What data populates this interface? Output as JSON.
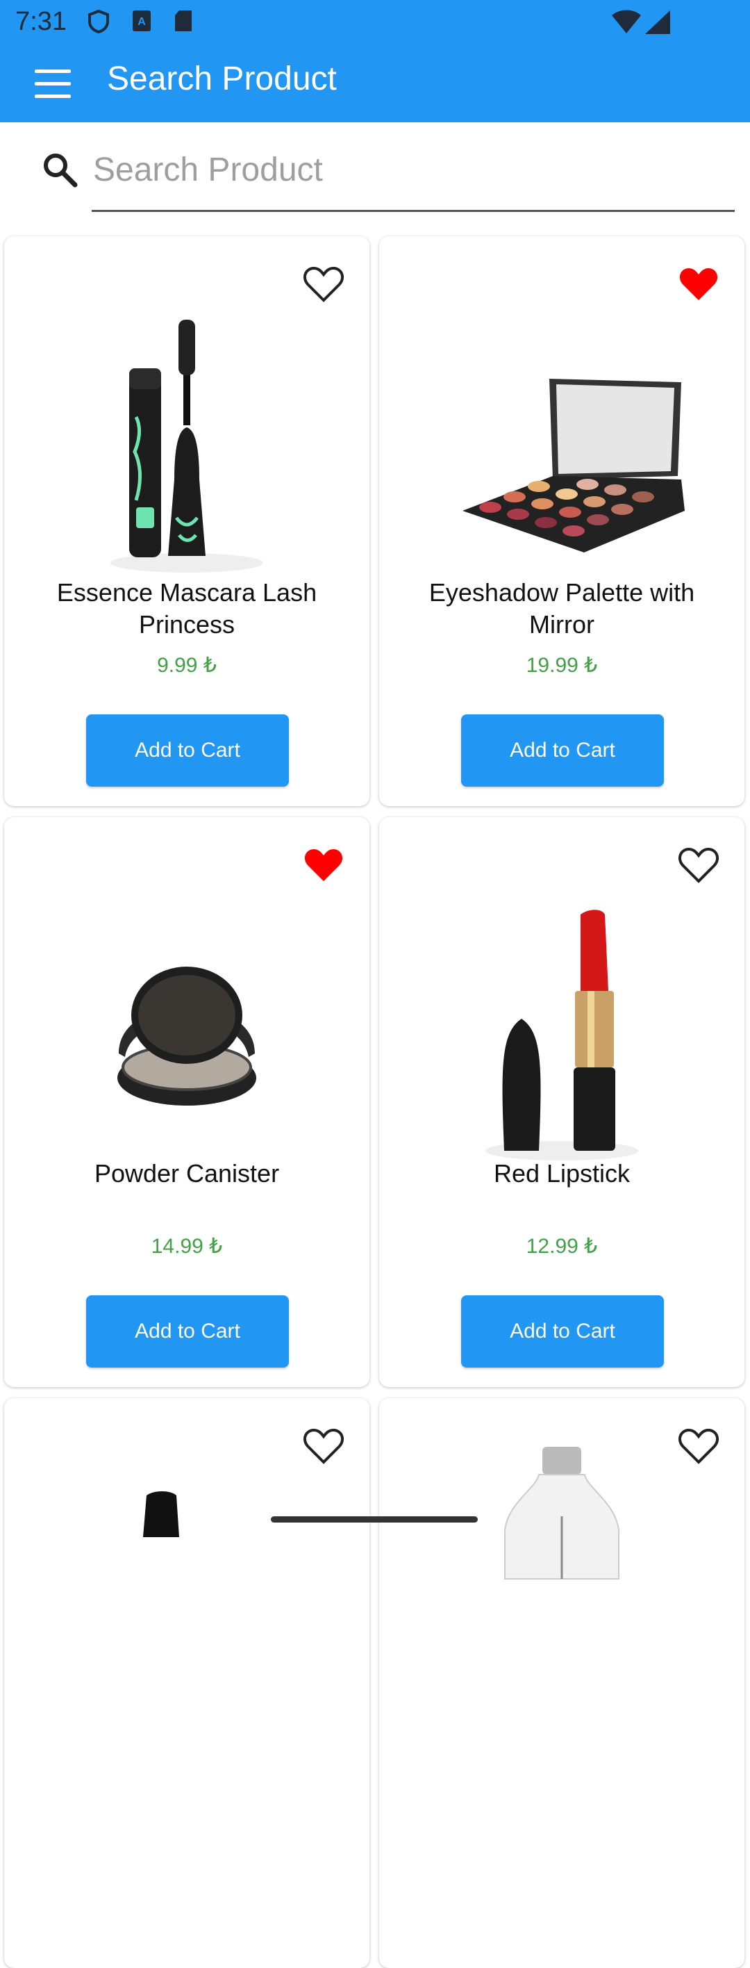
{
  "status_bar": {
    "time": "7:31",
    "icons": [
      "shield-icon",
      "a-font-icon",
      "sd-card-icon",
      "wifi-icon",
      "signal-icon"
    ]
  },
  "app_bar": {
    "title": "Search Product",
    "menu_icon": "hamburger-menu-icon"
  },
  "search": {
    "placeholder": "Search Product",
    "value": "",
    "icon": "search-icon"
  },
  "colors": {
    "primary": "#2196F3",
    "price": "#43A047",
    "favorite": "#FF0000"
  },
  "products": [
    {
      "name": "Essence Mascara Lash Princess",
      "price": "9.99 ₺",
      "favorite": false,
      "button": "Add to Cart"
    },
    {
      "name": "Eyeshadow Palette with Mirror",
      "price": "19.99 ₺",
      "favorite": true,
      "button": "Add to Cart"
    },
    {
      "name": "Powder Canister",
      "price": "14.99 ₺",
      "favorite": true,
      "button": "Add to Cart"
    },
    {
      "name": "Red Lipstick",
      "price": "12.99 ₺",
      "favorite": false,
      "button": "Add to Cart"
    },
    {
      "favorite": false
    },
    {
      "favorite": false
    }
  ]
}
